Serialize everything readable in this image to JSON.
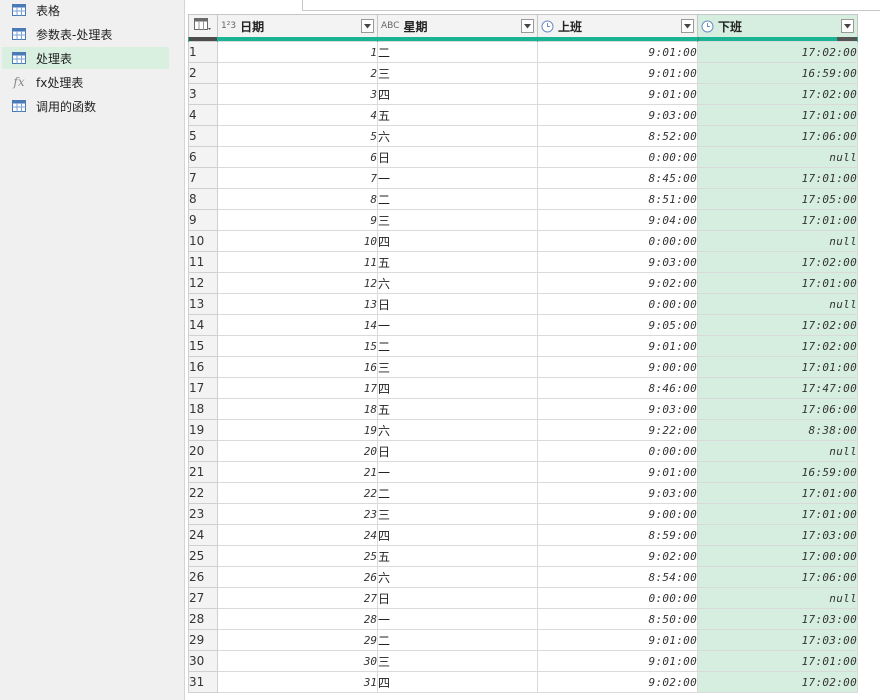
{
  "queries": [
    {
      "name": "表格",
      "icon": "table-icon",
      "selected": false
    },
    {
      "name": "参数表-处理表",
      "icon": "table-icon",
      "selected": false
    },
    {
      "name": "处理表",
      "icon": "table-icon",
      "selected": true
    },
    {
      "name": "fx处理表",
      "icon": "function-icon",
      "selected": false
    },
    {
      "name": "调用的函数",
      "icon": "table-icon",
      "selected": false
    }
  ],
  "columns": [
    {
      "name": "日期",
      "type_icon": "integer-type-icon",
      "type_label": "1²3"
    },
    {
      "name": "星期",
      "type_icon": "text-type-icon",
      "type_label": "ABC"
    },
    {
      "name": "上班",
      "type_icon": "time-type-icon",
      "type_label": ""
    },
    {
      "name": "下班",
      "type_icon": "time-type-icon",
      "type_label": ""
    }
  ],
  "rows": [
    [
      "1",
      "二",
      "9:01:00",
      "17:02:00"
    ],
    [
      "2",
      "三",
      "9:01:00",
      "16:59:00"
    ],
    [
      "3",
      "四",
      "9:01:00",
      "17:02:00"
    ],
    [
      "4",
      "五",
      "9:03:00",
      "17:01:00"
    ],
    [
      "5",
      "六",
      "8:52:00",
      "17:06:00"
    ],
    [
      "6",
      "日",
      "0:00:00",
      "null"
    ],
    [
      "7",
      "一",
      "8:45:00",
      "17:01:00"
    ],
    [
      "8",
      "二",
      "8:51:00",
      "17:05:00"
    ],
    [
      "9",
      "三",
      "9:04:00",
      "17:01:00"
    ],
    [
      "10",
      "四",
      "0:00:00",
      "null"
    ],
    [
      "11",
      "五",
      "9:03:00",
      "17:02:00"
    ],
    [
      "12",
      "六",
      "9:02:00",
      "17:01:00"
    ],
    [
      "13",
      "日",
      "0:00:00",
      "null"
    ],
    [
      "14",
      "一",
      "9:05:00",
      "17:02:00"
    ],
    [
      "15",
      "二",
      "9:01:00",
      "17:02:00"
    ],
    [
      "16",
      "三",
      "9:00:00",
      "17:01:00"
    ],
    [
      "17",
      "四",
      "8:46:00",
      "17:47:00"
    ],
    [
      "18",
      "五",
      "9:03:00",
      "17:06:00"
    ],
    [
      "19",
      "六",
      "9:22:00",
      "8:38:00"
    ],
    [
      "20",
      "日",
      "0:00:00",
      "null"
    ],
    [
      "21",
      "一",
      "9:01:00",
      "16:59:00"
    ],
    [
      "22",
      "二",
      "9:03:00",
      "17:01:00"
    ],
    [
      "23",
      "三",
      "9:00:00",
      "17:01:00"
    ],
    [
      "24",
      "四",
      "8:59:00",
      "17:03:00"
    ],
    [
      "25",
      "五",
      "9:02:00",
      "17:00:00"
    ],
    [
      "26",
      "六",
      "8:54:00",
      "17:06:00"
    ],
    [
      "27",
      "日",
      "0:00:00",
      "null"
    ],
    [
      "28",
      "一",
      "8:50:00",
      "17:03:00"
    ],
    [
      "29",
      "二",
      "9:01:00",
      "17:03:00"
    ],
    [
      "30",
      "三",
      "9:01:00",
      "17:01:00"
    ],
    [
      "31",
      "四",
      "9:02:00",
      "17:02:00"
    ]
  ],
  "colors": {
    "accent": "#1ab394",
    "selected_bg": "#d6eee0",
    "header_bg": "#f3f3f3"
  }
}
